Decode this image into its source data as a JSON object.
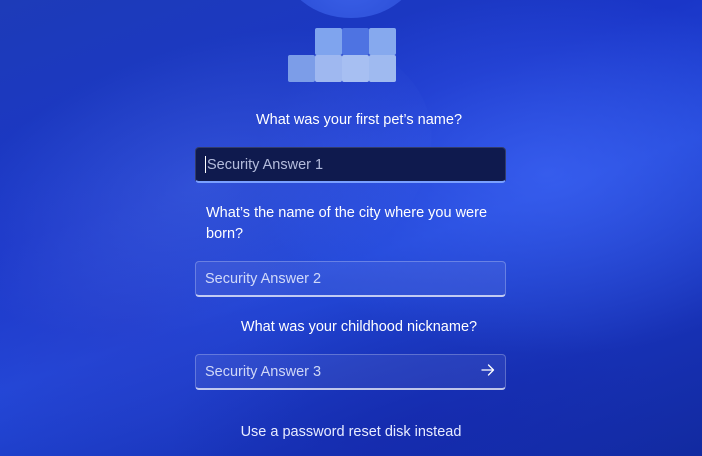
{
  "questions": [
    {
      "text": "What was your first pet’s name?",
      "placeholder": "Security Answer 1",
      "value": ""
    },
    {
      "text": "What’s the name of the city where you were born?",
      "placeholder": "Security Answer 2",
      "value": ""
    },
    {
      "text": "What was your childhood nickname?",
      "placeholder": "Security Answer 3",
      "value": ""
    }
  ],
  "submit_icon": "arrow-right-icon",
  "reset_link": "Use a password reset disk instead",
  "colors": {
    "background": "#1d3bb8",
    "active_field": "#0f1a4e",
    "focus_accent": "#7aa0ff"
  }
}
